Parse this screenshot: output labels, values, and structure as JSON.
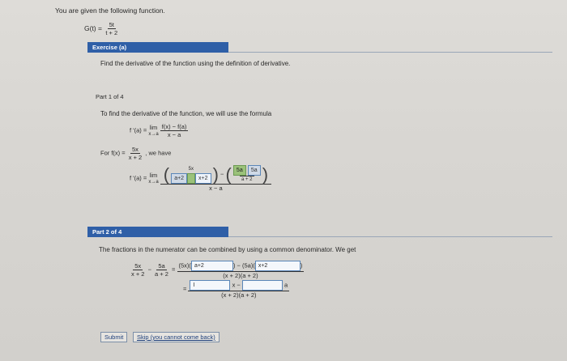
{
  "intro_text": "You are given the following function.",
  "function": {
    "lhs": "G(t) =",
    "num": "5t",
    "den": "t + 2"
  },
  "exercise": {
    "label": "Exercise (a)",
    "task": "Find the derivative of the function using the definition of derivative."
  },
  "part1": {
    "label": "Part 1 of 4",
    "intro": "To find the derivative of the function, we will use the formula",
    "formula": {
      "lhs": "f '(a) =",
      "lim": "lim",
      "lim_sub": "x→a",
      "num": "f(x) − f(a)",
      "den": "x − a"
    },
    "for_line": {
      "prefix": "For f(x) =",
      "num": "5x",
      "den": "x + 2",
      "suffix": ", we have"
    },
    "limit_expr": {
      "lhs": "f '(a) =",
      "lim": "lim",
      "lim_sub": "x→a",
      "top_num": "5x",
      "box_a_plus_2": "a+2",
      "box_x_plus_2": "x+2",
      "box_5a_green": "5a",
      "box_5a_filled": "5a",
      "small_den": "a + 2",
      "minus": "−",
      "bottom_den": "x − a"
    }
  },
  "part2": {
    "label": "Part 2 of 4",
    "intro": "The fractions in the numerator can be combined by using a common denominator. We get",
    "lhs_a_num": "5x",
    "lhs_a_den": "x + 2",
    "lhs_b_num": "5a",
    "lhs_b_den": "a + 2",
    "minus": "−",
    "equals": "=",
    "num_prefix": "(5x)(",
    "input_a_value": "a+2",
    "num_mid": ") − (5a)(",
    "input_b_value": "x+2",
    "num_suffix": ")",
    "den1": "(x + 2)(a + 2)",
    "row2_x": "x −",
    "row2_a": "a",
    "den2": "(x + 2)(a + 2)"
  },
  "buttons": {
    "submit": "Submit",
    "skip": "Skip (you cannot come back)"
  }
}
